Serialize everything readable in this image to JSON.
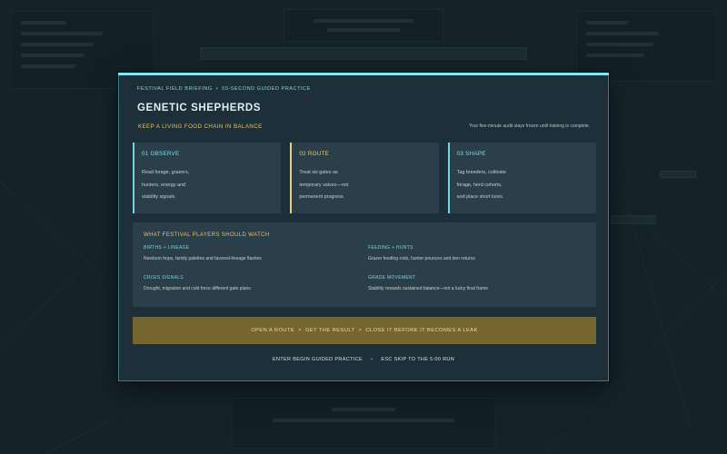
{
  "modal": {
    "kicker_left": "FESTIVAL FIELD BRIEFING",
    "kicker_sep": "•",
    "kicker_right": "50-SECOND GUIDED PRACTICE",
    "title": "GENETIC SHEPHERDS",
    "subtitle": "KEEP A LIVING FOOD CHAIN IN BALANCE",
    "note": "Your five-minute audit stays frozen until training is complete.",
    "cards": [
      {
        "head": "01  OBSERVE",
        "body": "Read forage, grazers,\nhunters, energy and\nstability signals.",
        "color": "#6fd7e6",
        "head_color": "#8fdde8"
      },
      {
        "head": "02  ROUTE",
        "body": "Treat six gates as\ntemporary valves—not\npermanent progress.",
        "color": "#e6d27a",
        "head_color": "#e6d27a"
      },
      {
        "head": "03  SHAPE",
        "body": "Tag breeders, cultivate\nforage, herd cohorts,\nand place short lures.",
        "color": "#6fd7e6",
        "head_color": "#8fdde8"
      }
    ],
    "watch": {
      "head": "WHAT FESTIVAL PLAYERS SHOULD WATCH",
      "items": [
        {
          "label": "BIRTHS + LINEAGE",
          "text": "Newborn hops, family palettes and favored-lineage flashes"
        },
        {
          "label": "FEEDING + HUNTS",
          "text": "Grazer feeding rods, hunter pounces and den returns"
        },
        {
          "label": "CRISIS SIGNALS",
          "text": "Drought, migration and cold force different gate plans"
        },
        {
          "label": "GRADE MOVEMENT",
          "text": "Stability rewards sustained balance—not a lucky final frame"
        }
      ]
    },
    "banner": {
      "step1": "OPEN A ROUTE",
      "arrow": ">",
      "step2": "GET THE RESULT",
      "step3": "CLOSE IT BEFORE IT BECOMES A LEAK"
    },
    "controls": {
      "enter": "ENTER  BEGIN GUIDED PRACTICE",
      "sep": "•",
      "esc": "ESC  SKIP TO THE 5:00 RUN"
    }
  },
  "colors": {
    "accent_cyan": "#7fe6f2",
    "accent_gold": "#e0c36a",
    "banner_bg": "#75652f"
  }
}
